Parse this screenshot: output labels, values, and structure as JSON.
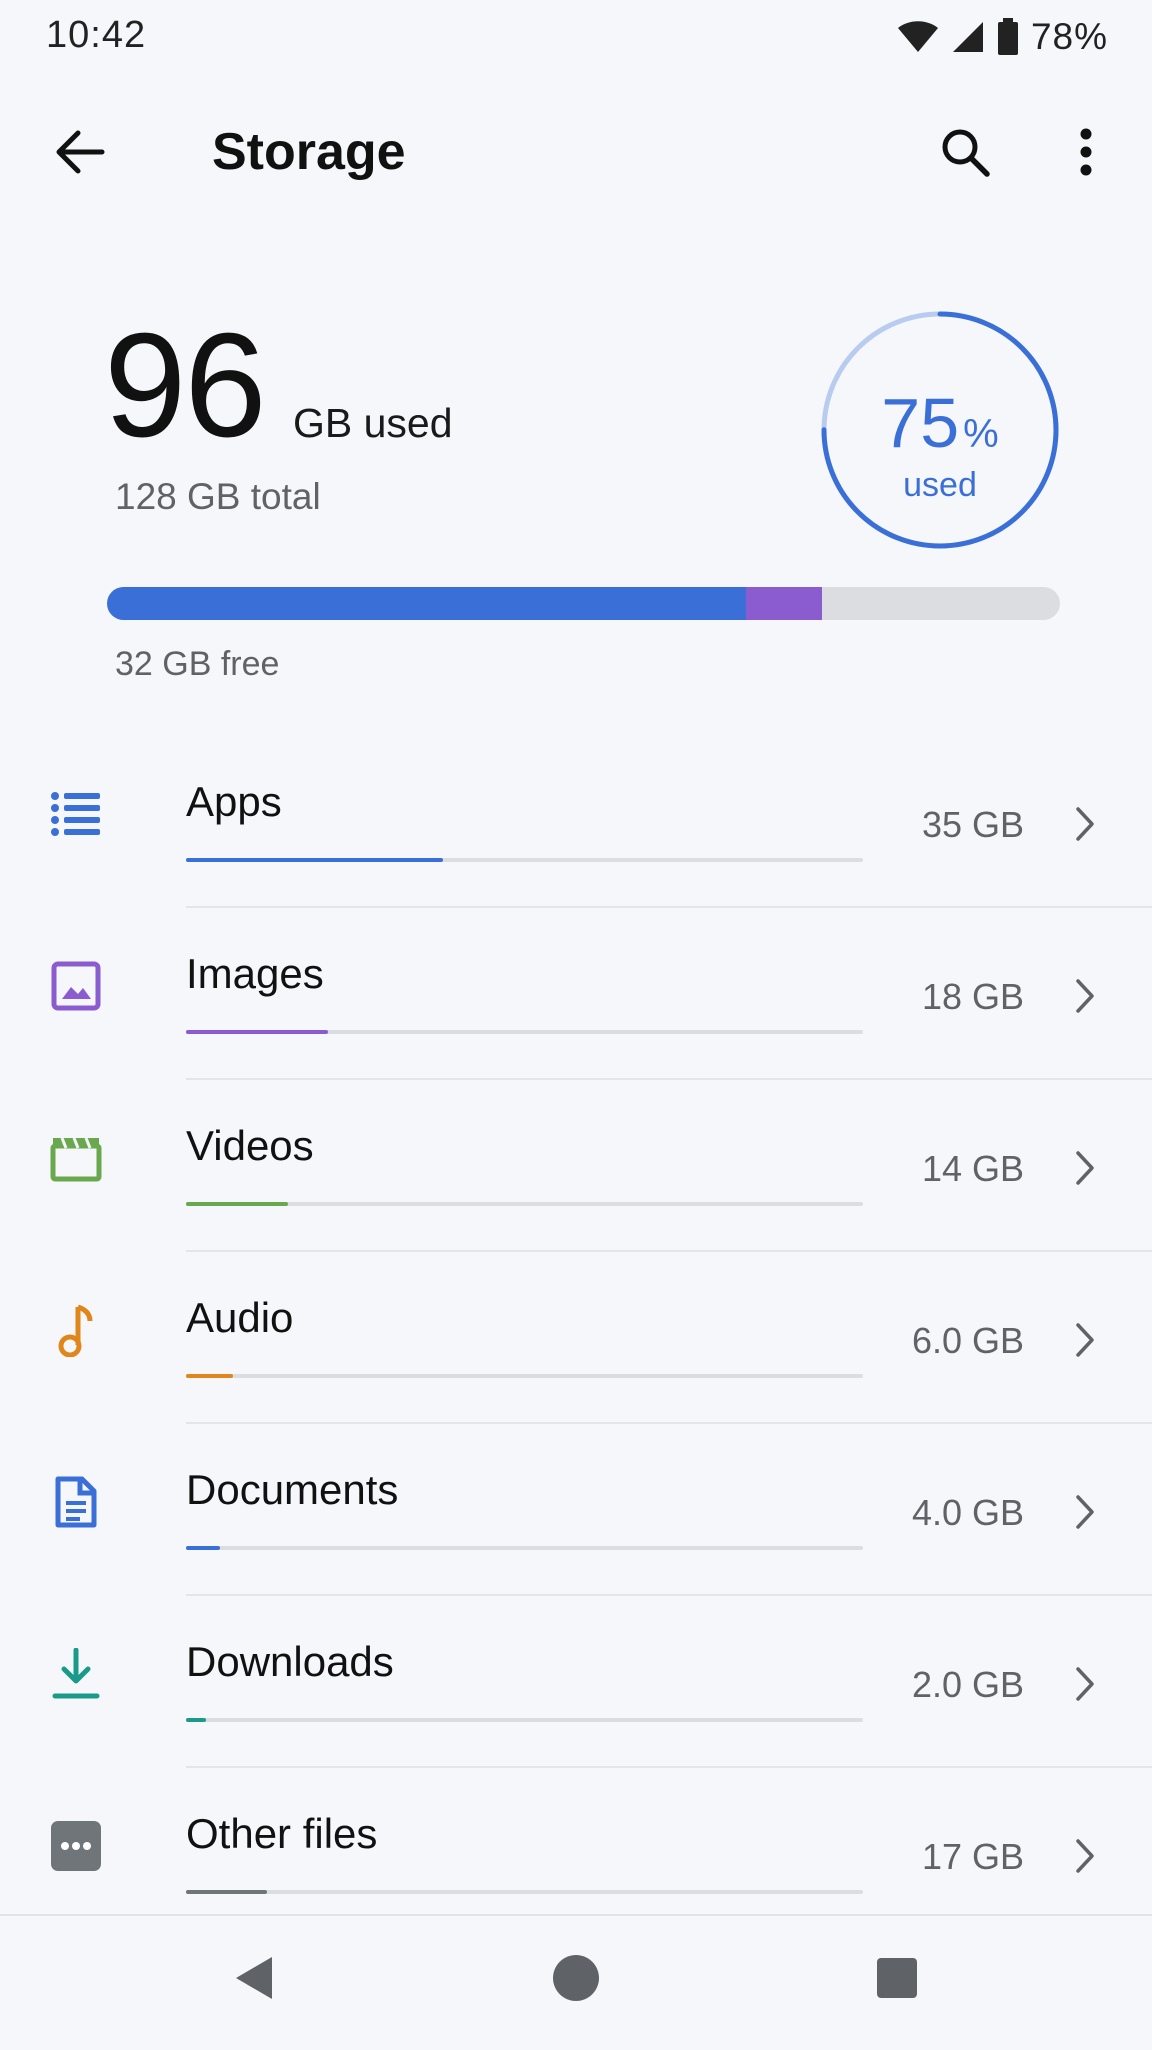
{
  "status_bar": {
    "time": "10:42",
    "battery": "78%",
    "icons": [
      "wifi-icon",
      "signal-icon",
      "battery-icon"
    ]
  },
  "app_bar": {
    "title": "Storage",
    "back_icon": "arrow-back-icon",
    "search_icon": "search-icon",
    "more_icon": "more-vert-icon"
  },
  "summary": {
    "used_value": "96",
    "used_unit": "GB used",
    "total": "128 GB total",
    "percent_value": "75",
    "percent_symbol": "%",
    "percent_label": "used",
    "used_fraction": 0.75,
    "free": "32 GB free",
    "bar": {
      "used_primary_fraction": 0.67,
      "used_accent_fraction": 0.08
    }
  },
  "categories": [
    {
      "label": "Apps",
      "size": "35 GB",
      "icon": "apps-list-icon",
      "color": "#3a6fd8",
      "fraction": 0.38
    },
    {
      "label": "Images",
      "size": "18 GB",
      "icon": "image-icon",
      "color": "#8a5ccf",
      "fraction": 0.21
    },
    {
      "label": "Videos",
      "size": "14 GB",
      "icon": "movie-icon",
      "color": "#6aa84f",
      "fraction": 0.15
    },
    {
      "label": "Audio",
      "size": "6.0 GB",
      "icon": "music-note-icon",
      "color": "#e0861a",
      "fraction": 0.07
    },
    {
      "label": "Documents",
      "size": "4.0 GB",
      "icon": "document-icon",
      "color": "#3a6fd8",
      "fraction": 0.05
    },
    {
      "label": "Downloads",
      "size": "2.0 GB",
      "icon": "download-icon",
      "color": "#1a9a8a",
      "fraction": 0.03
    },
    {
      "label": "Other files",
      "size": "17 GB",
      "icon": "more-horiz-icon",
      "color": "#70757a",
      "fraction": 0.12
    }
  ],
  "colors": {
    "accent": "#3a6fd8",
    "images": "#8a5ccf",
    "track": "#dcdde0",
    "background": "#f6f7fa"
  },
  "nav_bar": {
    "back_icon": "nav-back-icon",
    "home_icon": "nav-home-icon",
    "recents_icon": "nav-recents-icon"
  }
}
